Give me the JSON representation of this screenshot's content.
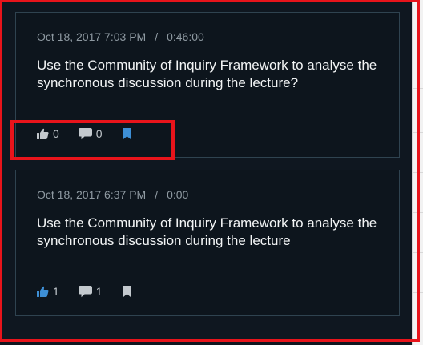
{
  "posts": [
    {
      "date": "Oct 18, 2017 7:03 PM",
      "separator": "/",
      "duration": "0:46:00",
      "text": "Use the Community of Inquiry Framework to analyse the synchronous discussion during the lecture?",
      "likes": "0",
      "comments": "0",
      "liked": false,
      "bookmarked": true
    },
    {
      "date": "Oct 18, 2017 6:37 PM",
      "separator": "/",
      "duration": "0:00",
      "text": "Use the Community of Inquiry Framework to analyse the synchronous discussion during the lecture",
      "likes": "1",
      "comments": "1",
      "liked": true,
      "bookmarked": false
    }
  ],
  "colors": {
    "highlight": "#e8141b",
    "accent_blue": "#3d8fd6",
    "panel_bg": "#0f1720"
  }
}
